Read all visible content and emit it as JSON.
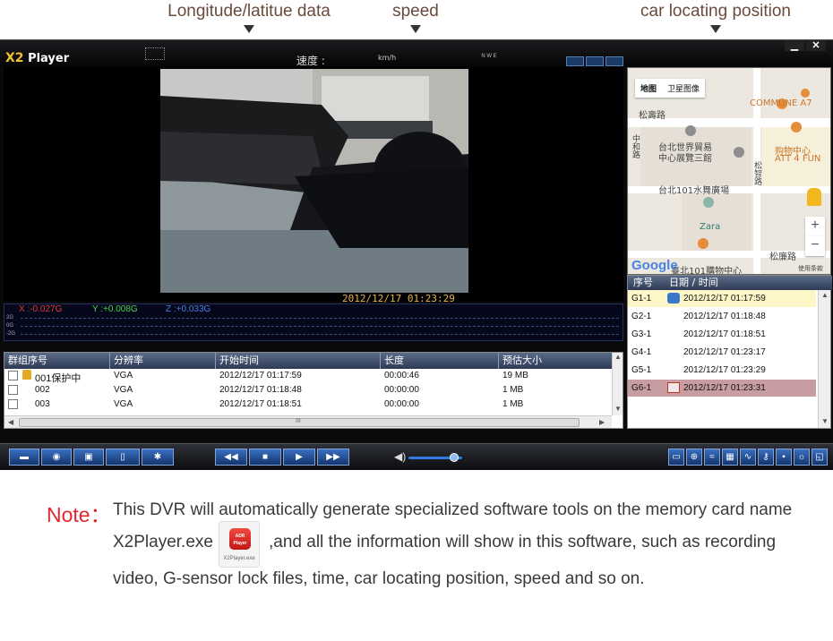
{
  "annotations": {
    "longitude": "Longitude/latitue data",
    "speed": "speed",
    "car_position": "car locating position"
  },
  "window": {
    "app_name_x2": "X2",
    "app_name_player": "Player",
    "speed_label": "速度 :",
    "speed_unit": "km/h",
    "compass_text": "N W E S",
    "minimize": "▁",
    "close": "✕"
  },
  "video": {
    "timestamp": "2012/12/17    01:23:29"
  },
  "gsensor": {
    "x": "X :-0.027G",
    "y": "Y :+0.008G",
    "z": "Z :+0.033G",
    "axis": [
      "2G",
      "0G",
      "-2G"
    ]
  },
  "files": {
    "columns": [
      "群组序号",
      "分辨率",
      "开始时间",
      "长度",
      "预估大小"
    ],
    "rows": [
      {
        "id": "001保护中",
        "res": "VGA",
        "start": "2012/12/17 01:17:59",
        "len": "00:00:46",
        "size": "19 MB",
        "locked": true
      },
      {
        "id": "002",
        "res": "VGA",
        "start": "2012/12/17 01:18:48",
        "len": "00:00:00",
        "size": "1 MB",
        "locked": false
      },
      {
        "id": "003",
        "res": "VGA",
        "start": "2012/12/17 01:18:51",
        "len": "00:00:00",
        "size": "1 MB",
        "locked": false
      }
    ],
    "hscroll_grip": "III"
  },
  "map": {
    "tabs": [
      "地图",
      "卫星图像"
    ],
    "labels": {
      "songshou": "松壽路",
      "commune": "COMMUNE A7",
      "world_trade": "台北世界貿易",
      "world_trade2": "中心展覽三館",
      "att": "购物中心",
      "att2": "ATT 4 FUN",
      "waterpark": "台北101水舞廣場",
      "zara": "Zara",
      "songlian": "松廉路",
      "mall101": "臺北101購物中心",
      "road_left": "中和路",
      "road_right": "松智路"
    },
    "google": "Google",
    "terms": "使用条款",
    "zoom_in": "+",
    "zoom_out": "−"
  },
  "events": {
    "columns": [
      "序号",
      "日期 / 时间"
    ],
    "rows": [
      {
        "id": "G1-1",
        "time": "2012/12/17  01:17:59",
        "state": "selected-yellow",
        "icon": "car-icon"
      },
      {
        "id": "G2-1",
        "time": "2012/12/17  01:18:48",
        "state": "",
        "icon": ""
      },
      {
        "id": "G3-1",
        "time": "2012/12/17  01:18:51",
        "state": "",
        "icon": ""
      },
      {
        "id": "G4-1",
        "time": "2012/12/17  01:23:17",
        "state": "",
        "icon": ""
      },
      {
        "id": "G5-1",
        "time": "2012/12/17  01:23:29",
        "state": "",
        "icon": ""
      },
      {
        "id": "G6-1",
        "time": "2012/12/17  01:23:31",
        "state": "selected-red",
        "icon": "photo-icon"
      }
    ]
  },
  "toolbar": {
    "left": [
      "folder-icon",
      "camera-icon",
      "save-icon",
      "delete-icon",
      "settings-icon"
    ],
    "transport": [
      "◀◀",
      "■",
      "▶",
      "▶▶"
    ],
    "volume": 0.85,
    "right": [
      "screenshot-icon",
      "network-icon",
      "wifi-icon",
      "map-icon",
      "wave-icon",
      "key-icon",
      "lock-icon",
      "brightness-icon",
      "fullscreen-icon"
    ]
  },
  "note": {
    "title": "Note：",
    "line1": "This DVR will automatically generate specialized software tools on the memory card name",
    "line2a": "X2Player.exe",
    "line2b": ",and all the information will show in this software, such as recording",
    "line3": "video, G-sensor lock files, time, car locating position, speed and so on.",
    "app_icon_text": "ADR Player",
    "app_icon_caption": "X2Player.exe"
  },
  "colors": {
    "note_red": "#e3262e",
    "annotation": "#6b4a3c",
    "timestamp": "#e8b34b",
    "accent_blue": "#2f7be0"
  }
}
